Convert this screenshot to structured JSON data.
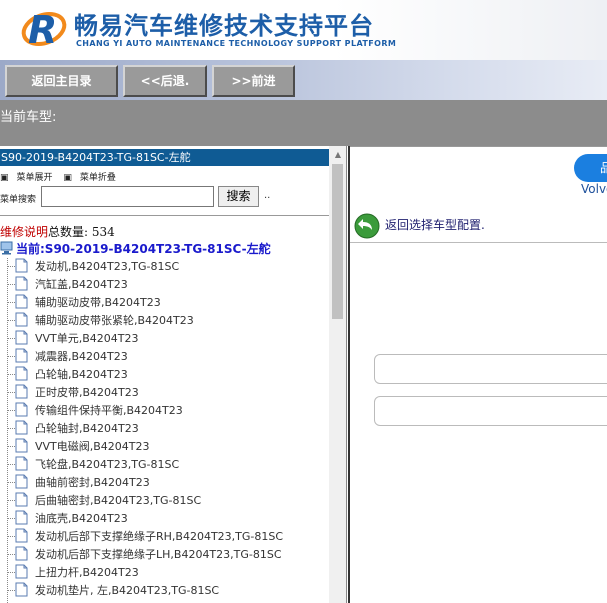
{
  "header": {
    "title": "畅易汽车维修技术支持平台",
    "subtitle": "CHANG YI AUTO MAINTENANCE TECHNOLOGY SUPPORT PLATFORM"
  },
  "toolbar": {
    "home_label": "返回主目录",
    "back_label": "<<后退.",
    "forward_label": ">>前进"
  },
  "model_bar": {
    "label": "当前车型:"
  },
  "left_panel": {
    "title": "S90-2019-B4204T23-TG-81SC-左舵",
    "expand_label": "菜单展开",
    "collapse_label": "菜单折叠",
    "search_label": "菜单搜索",
    "search_value": "",
    "search_button": "搜索",
    "search_dots": "..",
    "count_prefix": "维修说明",
    "count_label": "总数量:",
    "count_value": "534",
    "current_label": "当前:S90-2019-B4204T23-TG-81SC-左舵",
    "items": [
      "发动机,B4204T23,TG-81SC",
      "汽缸盖,B4204T23",
      "辅助驱动皮带,B4204T23",
      "辅助驱动皮带张紧轮,B4204T23",
      "VVT单元,B4204T23",
      "减震器,B4204T23",
      "凸轮轴,B4204T23",
      "正时皮带,B4204T23",
      "传输组件保持平衡,B4204T23",
      "凸轮轴封,B4204T23",
      "VVT电磁阀,B4204T23",
      "飞轮盘,B4204T23,TG-81SC",
      "曲轴前密封,B4204T23",
      "后曲轴密封,B4204T23,TG-81SC",
      "油底壳,B4204T23",
      "发动机后部下支撑绝缘子RH,B4204T23,TG-81SC",
      "发动机后部下支撑绝缘子LH,B4204T23,TG-81SC",
      "上扭力杆,B4204T23",
      "发动机垫片, 左,B4204T23,TG-81SC"
    ]
  },
  "right_panel": {
    "pill_label": "品",
    "brand_text": "Volvo",
    "back_link": "返回选择车型配置."
  },
  "colors": {
    "brand_blue": "#1d5ea8",
    "title_bar": "#0f5b94",
    "model_bar": "#8c8c8c",
    "pill_blue": "#1b7fe0"
  }
}
